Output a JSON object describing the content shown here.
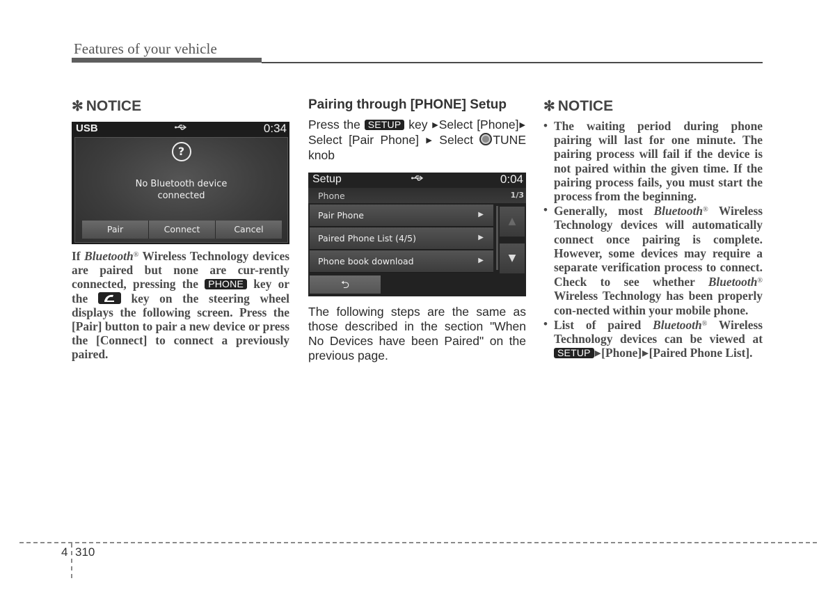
{
  "header": {
    "section_title": "Features of your vehicle"
  },
  "left_column": {
    "notice_star": "✻",
    "notice_title": "NOTICE",
    "screen": {
      "source_label": "USB",
      "status_icon": "usb-icon",
      "time": "0:34",
      "dialog_icon": "question-icon",
      "message_line1": "No Bluetooth device",
      "message_line2": "connected",
      "buttons": [
        "Pair",
        "Connect",
        "Cancel"
      ]
    },
    "para": {
      "p1": "If ",
      "bluetooth": "Bluetooth",
      "reg": "®",
      "p2": "  Wireless Technology devices are paired but none are cur-rently connected, pressing the ",
      "phone_key": "PHONE",
      "p3": " key or the ",
      "p4": " key on the steering wheel displays the following screen. Press the [Pair] button to pair a new device or press the [Connect] to connect a previously paired."
    }
  },
  "middle_column": {
    "heading": "Pairing through [PHONE] Setup",
    "instructions": {
      "t1": "Press the ",
      "setup_key": "SETUP",
      "t2": " key ",
      "t3": "Select [Phone]",
      "t4": "Select [Pair Phone] ",
      "t5": " Select ",
      "t6": "TUNE knob",
      "arrow": "▶"
    },
    "screen": {
      "title": "Setup",
      "status_icon": "usb-icon",
      "time": "0:04",
      "subtitle": "Phone",
      "page": "1/3",
      "items": [
        {
          "label": "Pair Phone",
          "arrow": "▶"
        },
        {
          "label": "Paired Phone List (4/5)",
          "arrow": "▶"
        },
        {
          "label": "Phone book download",
          "arrow": "▶"
        }
      ],
      "up_arrow": "▲",
      "down_arrow": "▼",
      "back_icon": "⮌"
    },
    "following_text": "The following steps are the same as those described in the section \"When No Devices have been Paired\" on the previous page."
  },
  "right_column": {
    "notice_star": "✻",
    "notice_title": "NOTICE",
    "bullet_char": "•",
    "bullets": {
      "b1": "The waiting period during phone pairing will last for one minute. The pairing process will fail if the device is not paired within the given time. If the pairing process fails, you must start the process from the beginning.",
      "b2_a": "Generally, most ",
      "b2_bt": "Bluetooth",
      "b2_b": " Wireless Technology devices will automatically connect once pairing is complete. However, some devices may require a separate verification process to connect. Check to see whether ",
      "b2_c": " Wireless Technology has been properly con-nected within your mobile phone.",
      "b3_a": "List of paired ",
      "b3_bt": "Bluetooth",
      "b3_b": "  Wireless Technology devices can be viewed at ",
      "b3_key": "SETUP",
      "b3_c": "[Phone]",
      "b3_d": "[Paired Phone List].",
      "reg": "®",
      "arrow": "▶"
    }
  },
  "footer": {
    "chapter": "4",
    "page": "310"
  }
}
